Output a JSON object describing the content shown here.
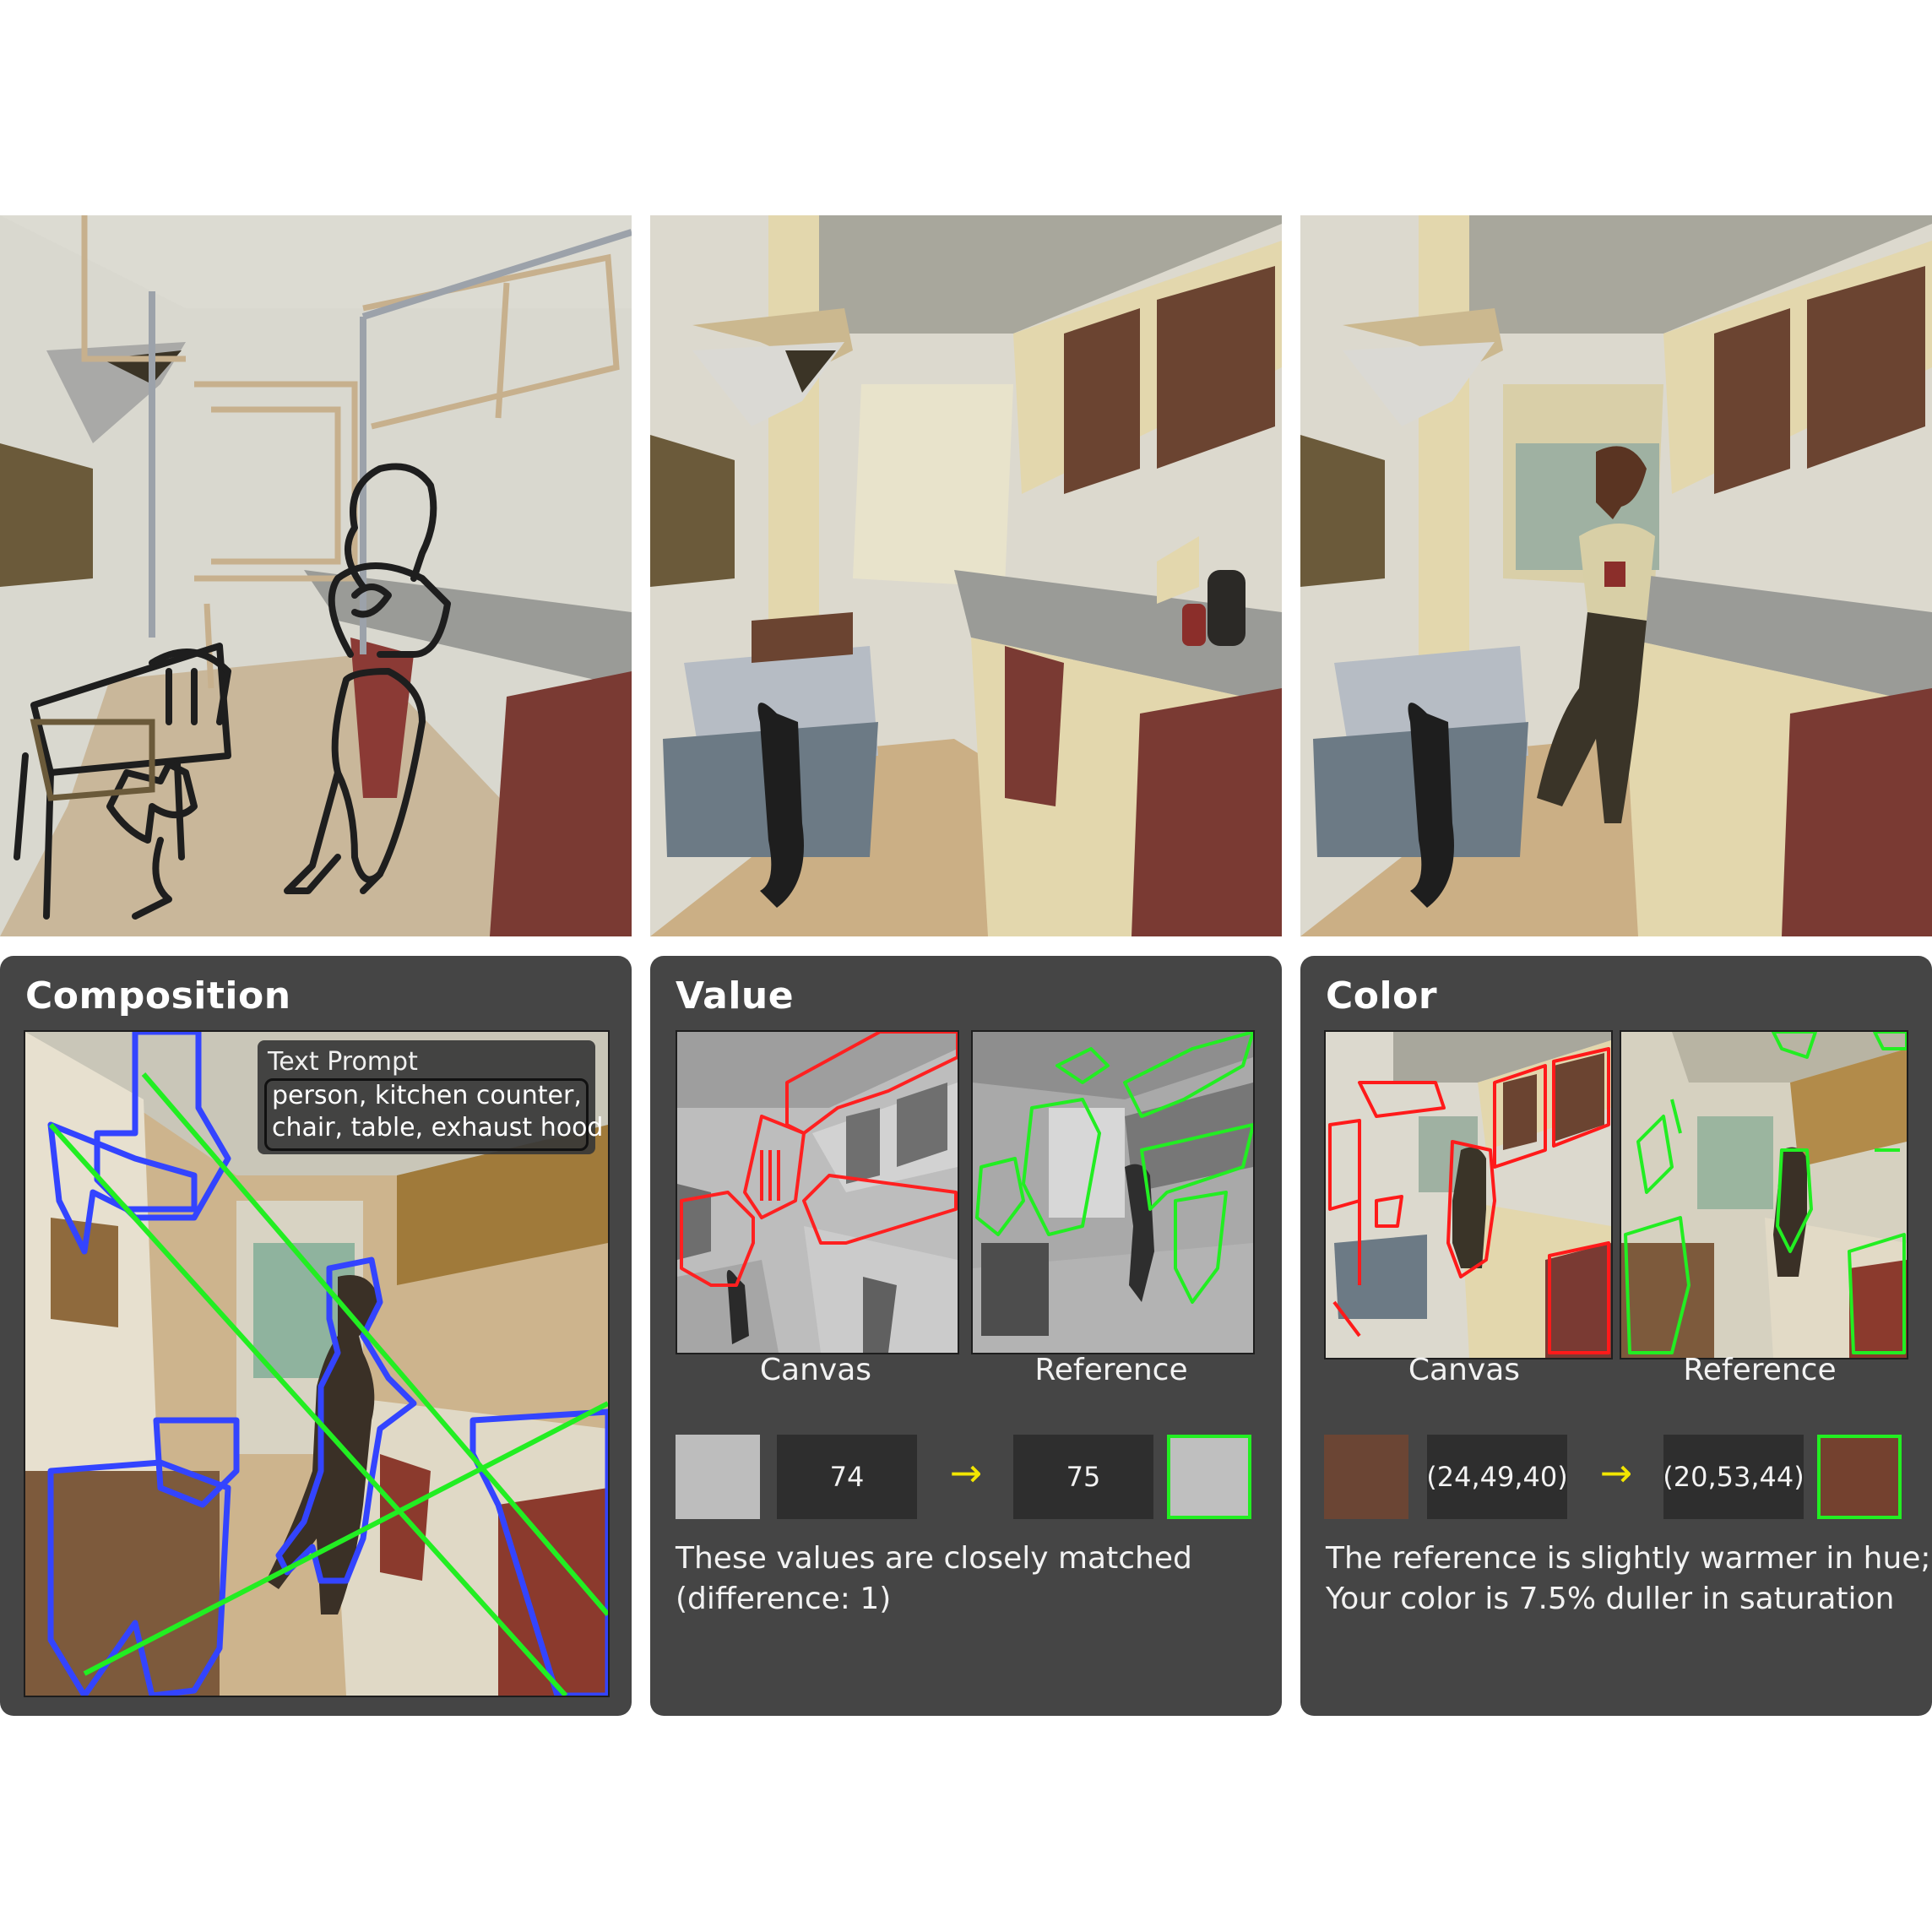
{
  "panels": {
    "composition": {
      "title": "Composition",
      "text_prompt": {
        "title": "Text Prompt",
        "lines": [
          "person, kitchen counter,",
          "chair, table, exhaust hood"
        ]
      }
    },
    "value": {
      "title": "Value",
      "canvas_label": "Canvas",
      "reference_label": "Reference",
      "canvas_value": "74",
      "reference_value": "75",
      "canvas_swatch_color": "#bdbdbd",
      "reference_swatch_color": "#bfbfbf",
      "description": [
        "These values are closely matched",
        "(difference: 1)"
      ]
    },
    "color": {
      "title": "Color",
      "canvas_label": "Canvas",
      "reference_label": "Reference",
      "canvas_value": "(24,49,40)",
      "reference_value": "(20,53,44)",
      "canvas_swatch_color": "#6b4534",
      "reference_swatch_color": "#74412f",
      "description": [
        "The reference is slightly warmer in hue;",
        "Your color is 7.5% duller in saturation"
      ]
    }
  },
  "colors": {
    "panel_bg": "#454545",
    "canvas_outline": "#ff2020",
    "reference_outline": "#22ee22",
    "segment_outline": "#3344ff",
    "composition_line": "#22ee22",
    "arrow": "#f2e600"
  }
}
